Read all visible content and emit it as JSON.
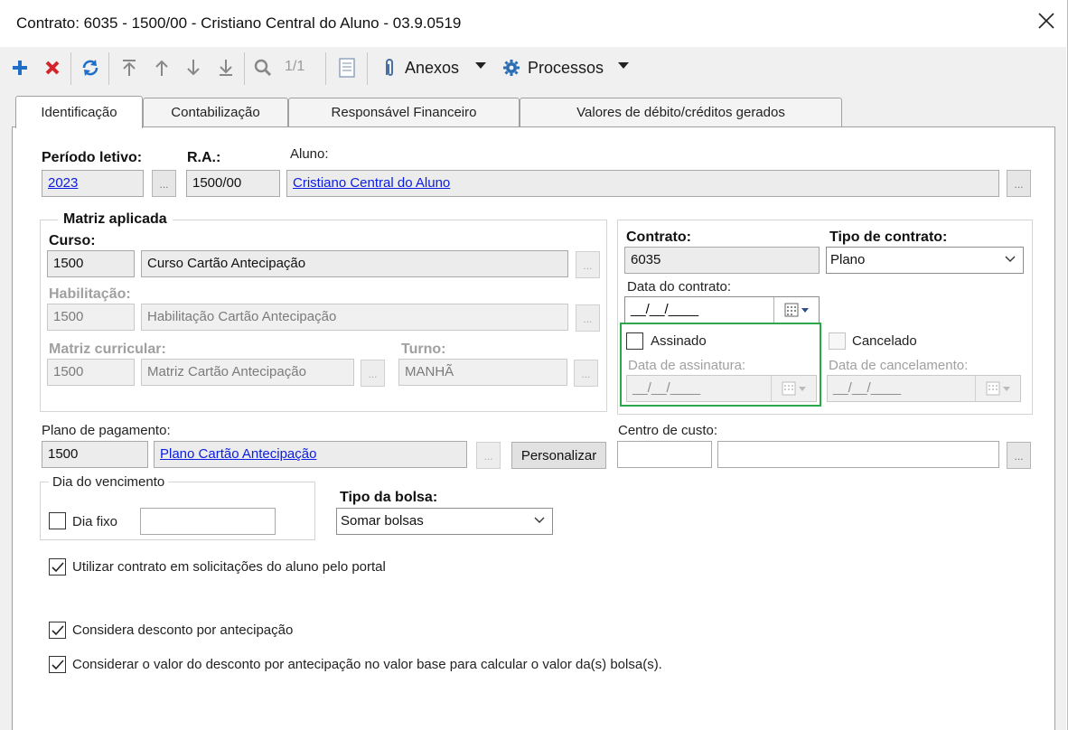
{
  "window": {
    "title": "Contrato: 6035 - 1500/00 - Cristiano Central do Aluno - 03.9.0519"
  },
  "toolbar": {
    "counter": "1/1",
    "anexos_label": "Anexos",
    "processos_label": "Processos"
  },
  "tabs": [
    {
      "label": "Identificação",
      "active": true
    },
    {
      "label": "Contabilização",
      "active": false
    },
    {
      "label": "Responsável Financeiro",
      "active": false
    },
    {
      "label": "Valores de débito/créditos gerados",
      "active": false
    }
  ],
  "form": {
    "periodo_letivo_label": "Período letivo:",
    "periodo_letivo_value": "2023",
    "ra_label": "R.A.:",
    "ra_value": "1500/00",
    "aluno_label": "Aluno:",
    "aluno_value": "Cristiano Central do Aluno",
    "matriz_group_label": "Matriz aplicada",
    "curso_label": "Curso:",
    "curso_code": "1500",
    "curso_name": "Curso Cartão Antecipação",
    "habilitacao_label": "Habilitação:",
    "habilitacao_code": "1500",
    "habilitacao_name": "Habilitação Cartão Antecipação",
    "matriz_curricular_label": "Matriz curricular:",
    "matriz_code": "1500",
    "matriz_name": "Matriz Cartão Antecipação",
    "turno_label": "Turno:",
    "turno_value": "MANHÃ",
    "contrato_label": "Contrato:",
    "contrato_value": "6035",
    "tipo_contrato_label": "Tipo de contrato:",
    "tipo_contrato_value": "Plano",
    "data_contrato_label": "Data do contrato:",
    "data_contrato_value": "__/__/____",
    "assinado_label": "Assinado",
    "assinado_checked": false,
    "data_assinatura_label": "Data de assinatura:",
    "data_assinatura_value": "__/__/____",
    "cancelado_label": "Cancelado",
    "cancelado_checked": false,
    "data_cancelamento_label": "Data de cancelamento:",
    "data_cancelamento_value": "__/__/____",
    "plano_pagamento_label": "Plano de pagamento:",
    "plano_code": "1500",
    "plano_name": "Plano Cartão Antecipação",
    "personalizar_label": "Personalizar",
    "centro_custo_label": "Centro de custo:",
    "centro_custo_code": "",
    "centro_custo_name": "",
    "dia_vencimento_group_label": "Dia do vencimento",
    "dia_fixo_label": "Dia fixo",
    "dia_fixo_checked": false,
    "dia_fixo_value": "",
    "tipo_bolsa_label": "Tipo da bolsa:",
    "tipo_bolsa_value": "Somar bolsas",
    "opt_portal_label": "Utilizar contrato em solicitações do aluno pelo portal",
    "opt_portal_checked": true,
    "opt_desconto_label": "Considera desconto por antecipação",
    "opt_desconto_checked": true,
    "opt_valor_base_label": "Considerar o valor do desconto por antecipação no valor base para calcular o valor da(s) bolsa(s).",
    "opt_valor_base_checked": true,
    "browse_label": "..."
  },
  "colors": {
    "highlight_border": "#2aa84a",
    "link": "#0a1de0",
    "add_icon": "#1f6fc7",
    "delete_icon": "#d4232a"
  }
}
